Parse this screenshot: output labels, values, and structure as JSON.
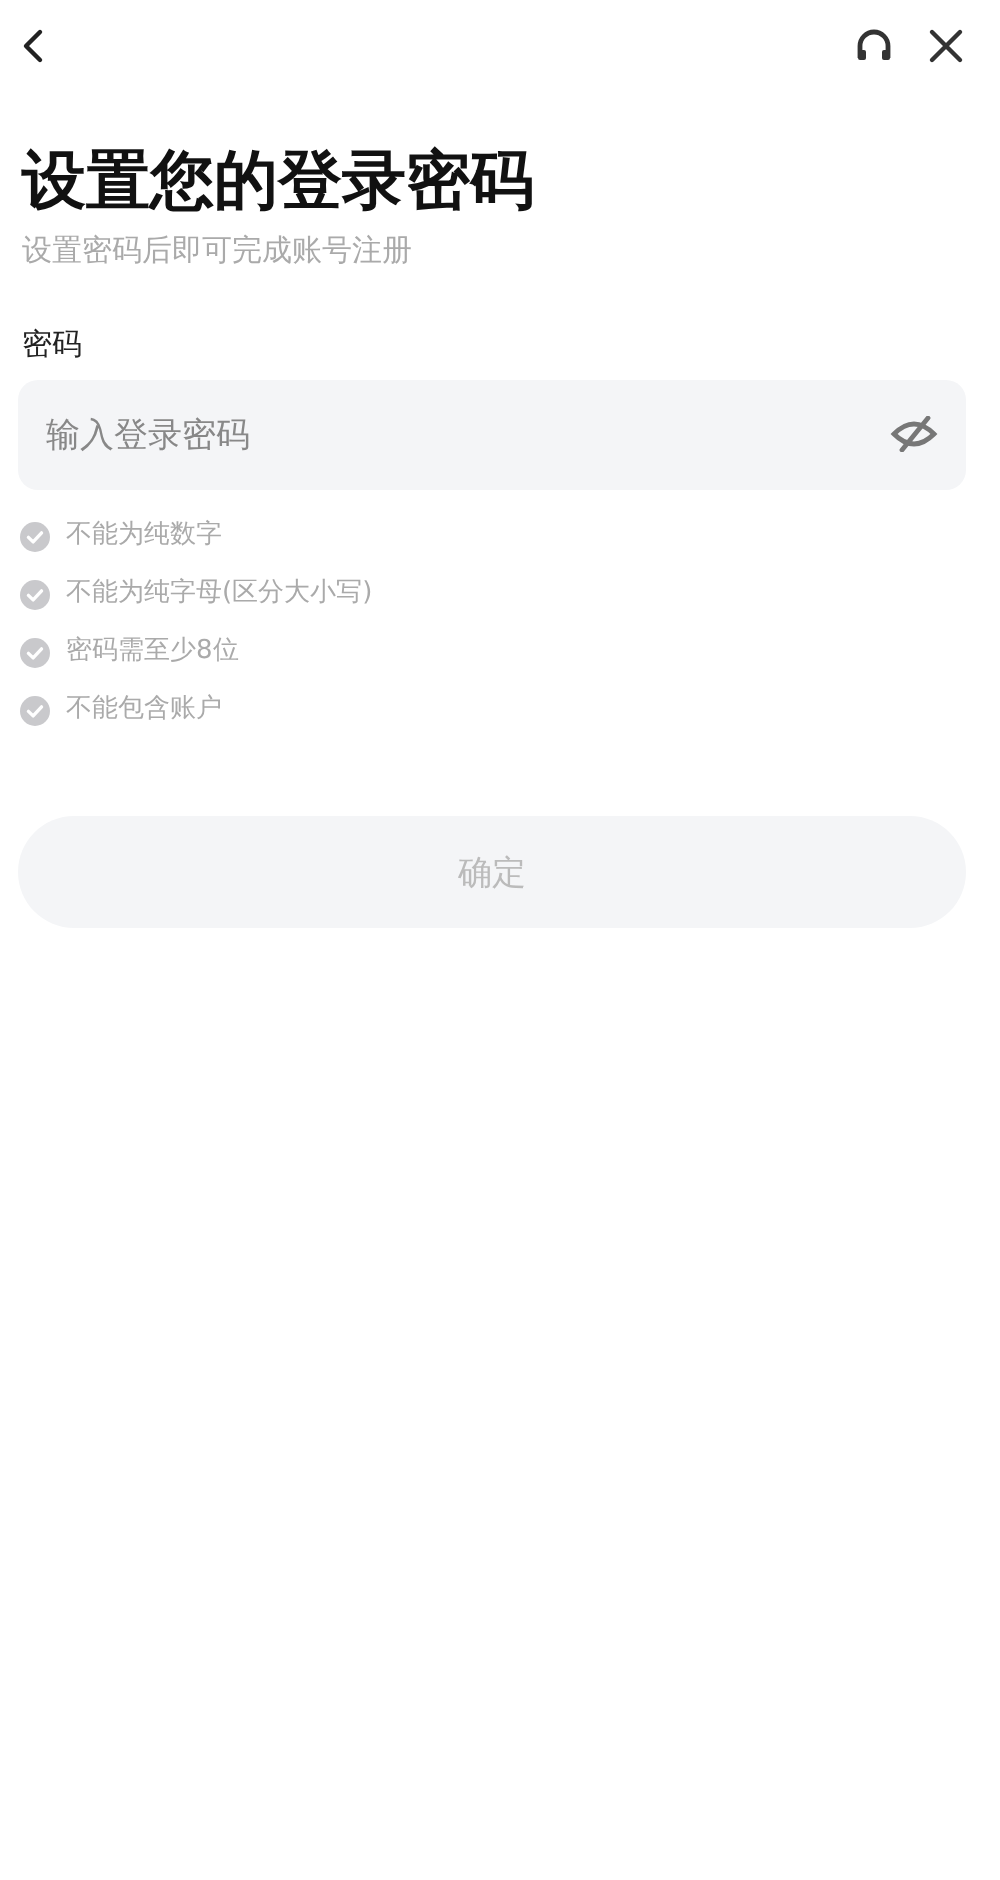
{
  "title": "设置您的登录密码",
  "subtitle": "设置密码后即可完成账号注册",
  "password": {
    "label": "密码",
    "placeholder": "输入登录密码",
    "visible": false
  },
  "rules": [
    {
      "text": "不能为纯数字",
      "met": false
    },
    {
      "text": "不能为纯字母(区分大小写)",
      "met": false
    },
    {
      "text": "密码需至少8位",
      "met": false
    },
    {
      "text": "不能包含账户",
      "met": false
    }
  ],
  "submit": {
    "label": "确定",
    "disabled": true
  }
}
